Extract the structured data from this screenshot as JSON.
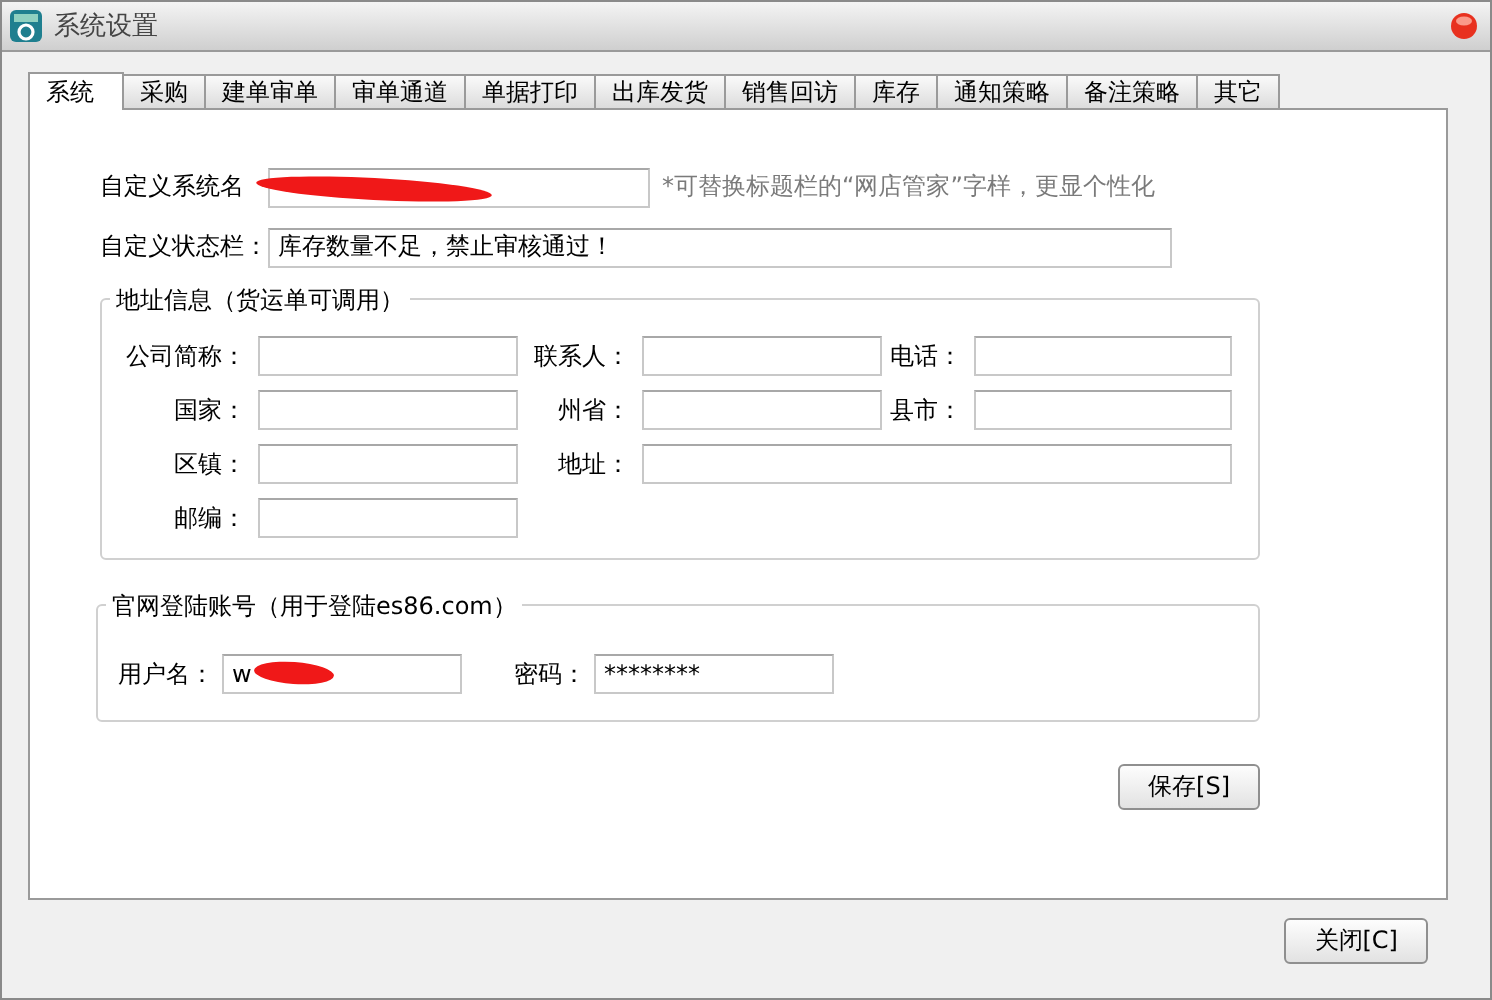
{
  "window": {
    "title": "系统设置"
  },
  "tabs": [
    {
      "label": "系统",
      "selected": true
    },
    {
      "label": "采购",
      "selected": false
    },
    {
      "label": "建单审单",
      "selected": false
    },
    {
      "label": "审单通道",
      "selected": false
    },
    {
      "label": "单据打印",
      "selected": false
    },
    {
      "label": "出库发货",
      "selected": false
    },
    {
      "label": "销售回访",
      "selected": false
    },
    {
      "label": "库存",
      "selected": false
    },
    {
      "label": "通知策略",
      "selected": false
    },
    {
      "label": "备注策略",
      "selected": false
    },
    {
      "label": "其它",
      "selected": false
    }
  ],
  "fields": [
    {
      "label": "自定义系统名",
      "redacted": true,
      "hint": "*可替换标题栏的“网店管家”字样，更显个性化"
    },
    {
      "label": "自定义状态栏：",
      "value": "库存数量不足，禁止审核通过！"
    }
  ],
  "address_group": {
    "title": "地址信息（货运单可调用）",
    "fields": [
      {
        "label": "公司简称："
      },
      {
        "label": "联系人："
      },
      {
        "label": "电话："
      },
      {
        "label": "国家："
      },
      {
        "label": "州省："
      },
      {
        "label": "县市："
      },
      {
        "label": "区镇："
      },
      {
        "label": "地址：",
        "wide": true
      },
      {
        "label": "邮编："
      }
    ]
  },
  "login_group": {
    "title": "官网登陆账号（用于登陆es86.com）",
    "fields": [
      {
        "label": "用户名：",
        "value": "w",
        "redacted": true
      },
      {
        "label": "密码：",
        "value": "********"
      }
    ]
  },
  "save_button": "保存[S]",
  "close_button": "关闭[C]"
}
